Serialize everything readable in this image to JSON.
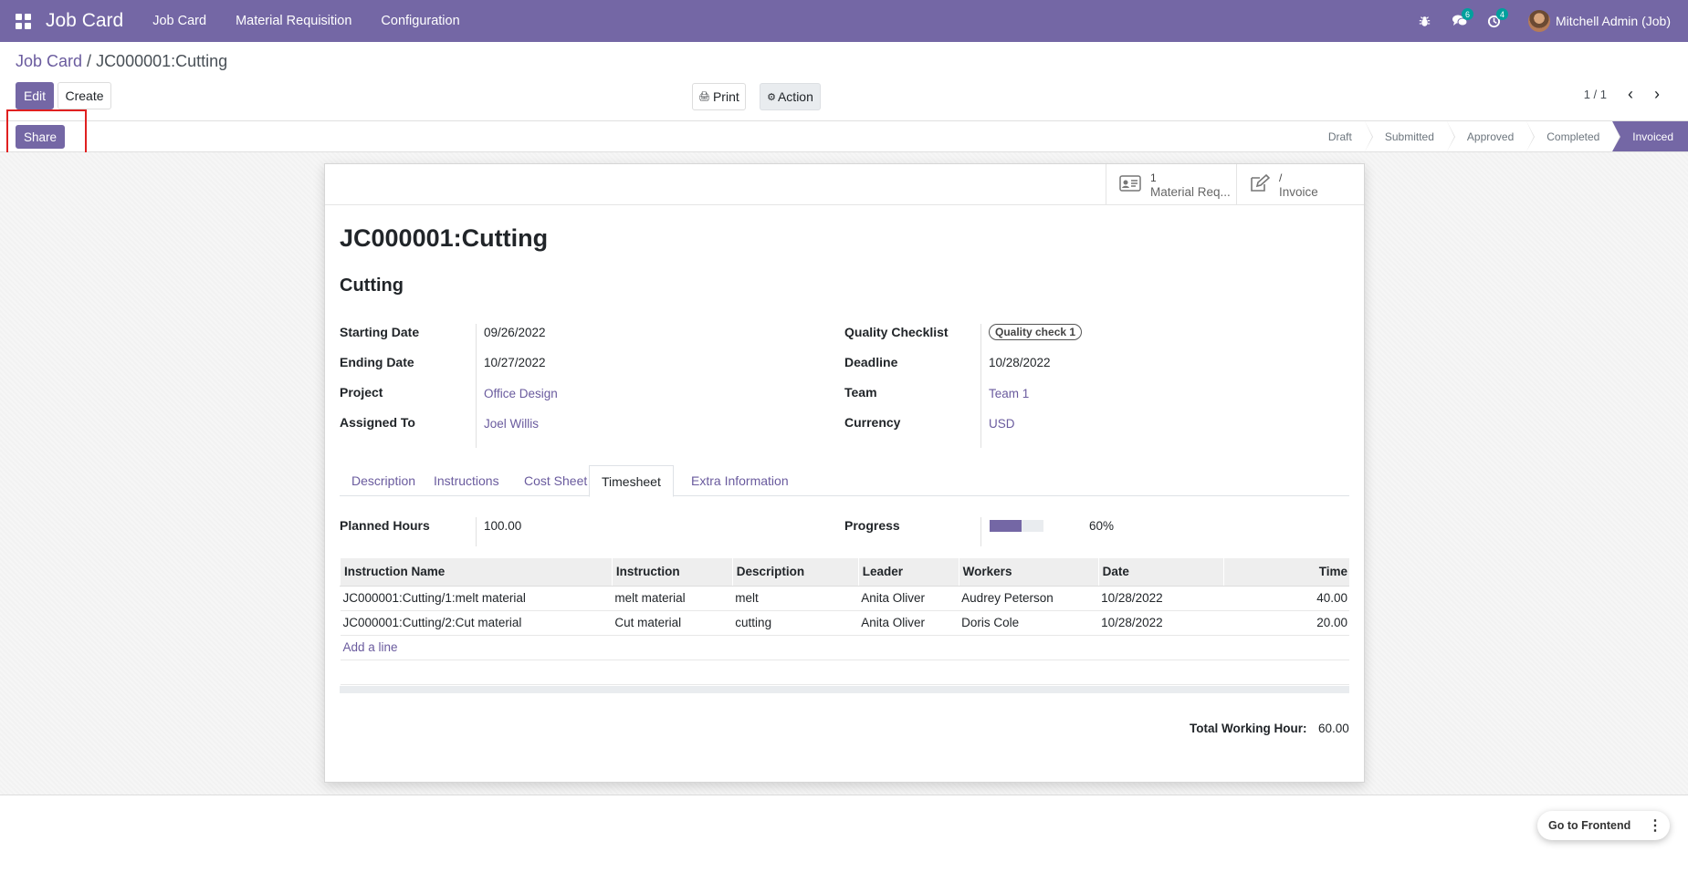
{
  "navbar": {
    "brand": "Job Card",
    "menus": [
      "Job Card",
      "Material Requisition",
      "Configuration"
    ],
    "messages_count": "6",
    "activities_count": "4",
    "user": "Mitchell Admin (Job)"
  },
  "breadcrumb": {
    "parent": "Job Card",
    "separator": " / ",
    "current": "JC000001:Cutting"
  },
  "toolbar": {
    "edit": "Edit",
    "create": "Create",
    "print": "Print",
    "action": "Action",
    "pager": "1 / 1",
    "share": "Share"
  },
  "status_steps": [
    "Draft",
    "Submitted",
    "Approved",
    "Completed",
    "Invoiced"
  ],
  "smart_buttons": {
    "material": {
      "value": "1",
      "label": "Material Req..."
    },
    "invoice": {
      "value": "/",
      "label": "Invoice"
    }
  },
  "record": {
    "title": "JC000001:Cutting",
    "subtitle": "Cutting",
    "starting_date_label": "Starting Date",
    "starting_date": "09/26/2022",
    "ending_date_label": "Ending Date",
    "ending_date": "10/27/2022",
    "project_label": "Project",
    "project": "Office Design",
    "assigned_label": "Assigned To",
    "assigned": "Joel Willis",
    "quality_label": "Quality Checklist",
    "quality": "Quality check 1",
    "deadline_label": "Deadline",
    "deadline": "10/28/2022",
    "team_label": "Team",
    "team": "Team 1",
    "currency_label": "Currency",
    "currency": "USD"
  },
  "tabs": [
    "Description",
    "Instructions",
    "Cost Sheet",
    "Timesheet",
    "Extra Information"
  ],
  "timesheet": {
    "planned_label": "Planned Hours",
    "planned": "100.00",
    "progress_label": "Progress",
    "progress_text": "60%",
    "progress_value": 60,
    "columns": [
      "Instruction Name",
      "Instruction",
      "Description",
      "Leader",
      "Workers",
      "Date",
      "Time"
    ],
    "rows": [
      [
        "JC000001:Cutting/1:melt material",
        "melt material",
        "melt",
        "Anita Oliver",
        "Audrey Peterson",
        "10/28/2022",
        "40.00"
      ],
      [
        "JC000001:Cutting/2:Cut material",
        "Cut material",
        "cutting",
        "Anita Oliver",
        "Doris Cole",
        "10/28/2022",
        "20.00"
      ]
    ],
    "add_line": "Add a line",
    "total_label": "Total Working Hour:",
    "total": "60.00"
  },
  "frontend_button": "Go to Frontend",
  "colors": {
    "brand": "#7467a5",
    "highlight": "#e02020"
  }
}
